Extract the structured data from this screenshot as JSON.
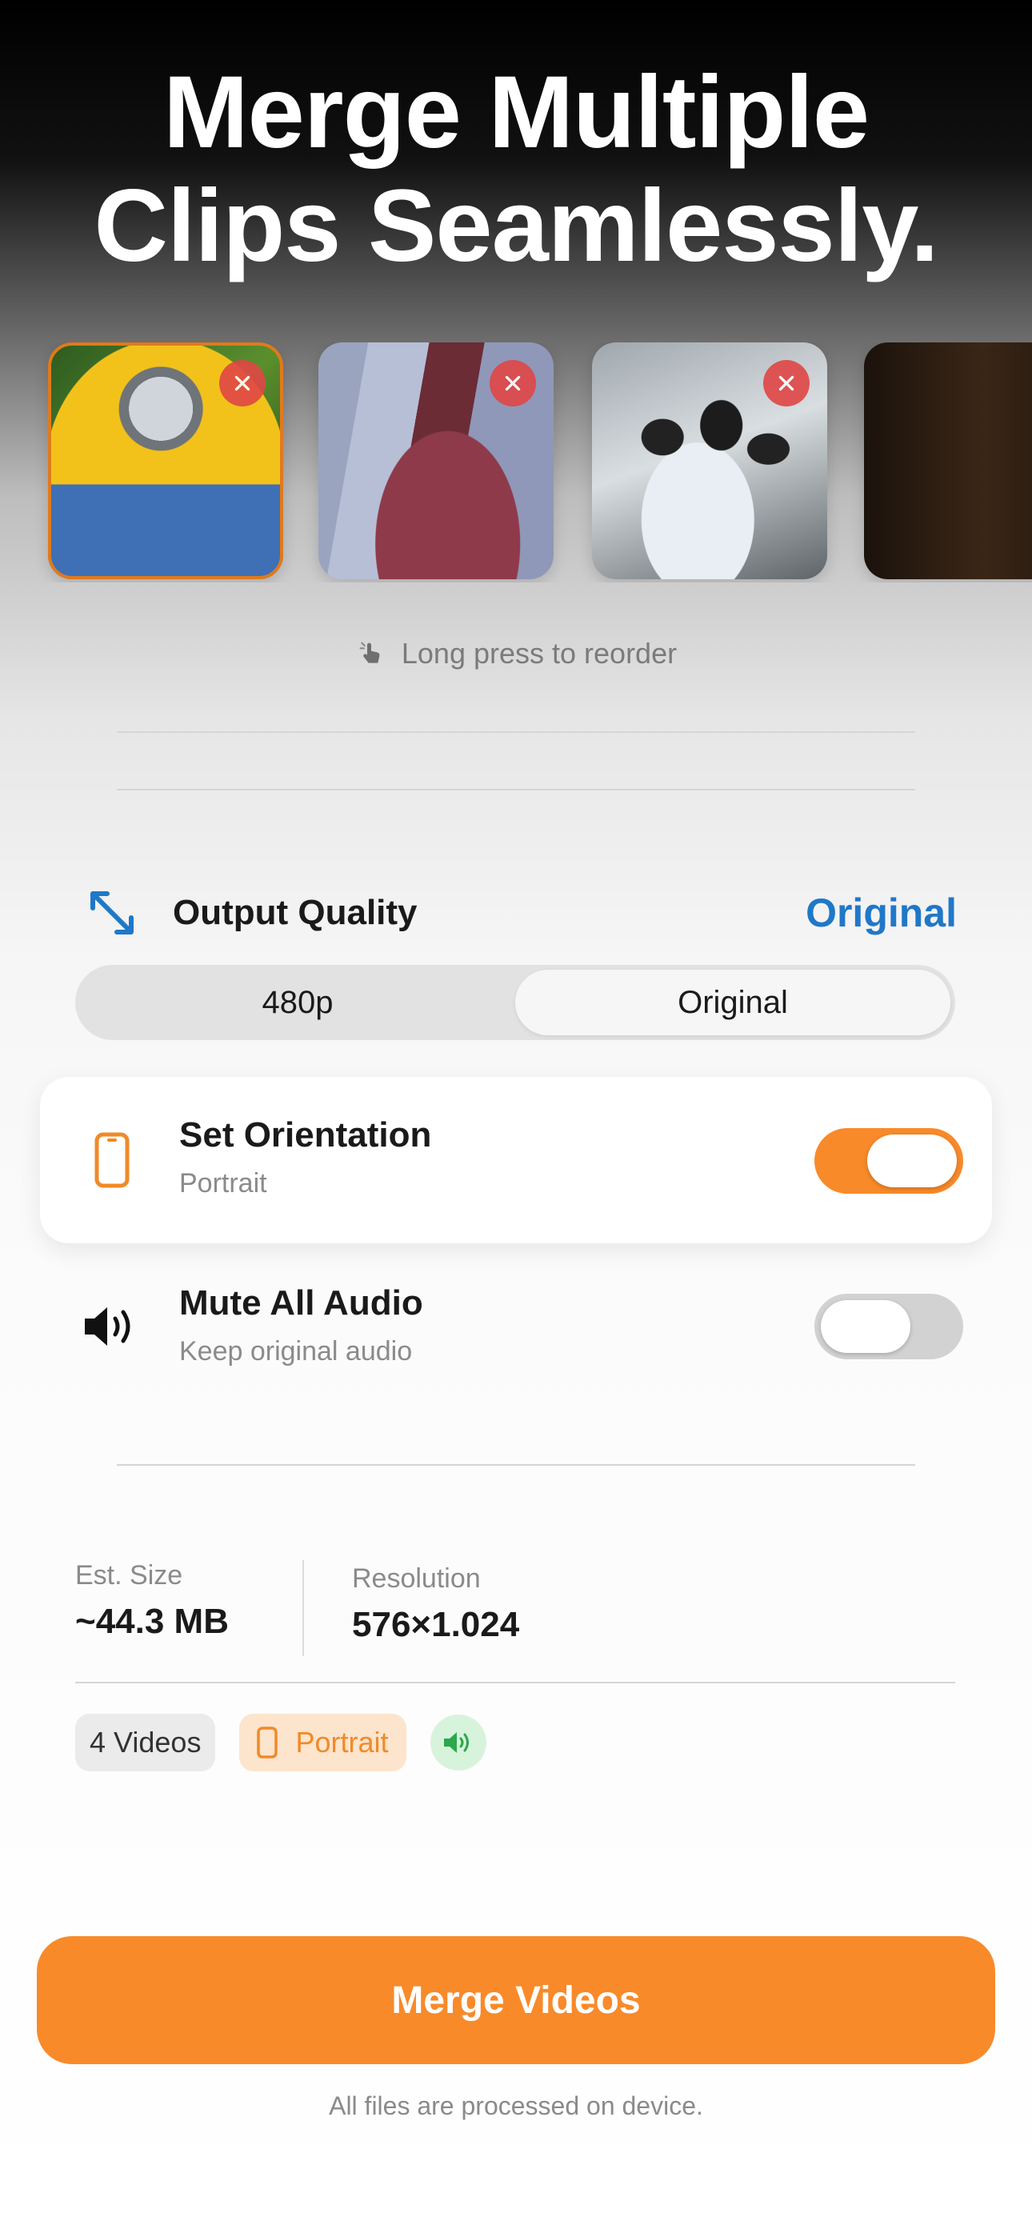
{
  "headline": {
    "line1": "Merge Multiple",
    "line2": "Clips Seamlessly."
  },
  "clips": [
    {
      "selected": true
    },
    {
      "selected": false
    },
    {
      "selected": false
    },
    {
      "selected": false
    }
  ],
  "hint": {
    "text": "Long press to reorder",
    "icon": "hand-pointer-icon"
  },
  "quality": {
    "title": "Output Quality",
    "value": "Original",
    "options": [
      "480p",
      "Original"
    ],
    "selected": "Original",
    "icon": "expand-arrows-icon",
    "accent": "#1f78c8"
  },
  "orientation": {
    "title": "Set Orientation",
    "subtitle": "Portrait",
    "enabled": true,
    "icon": "phone-portrait-icon"
  },
  "mute": {
    "title": "Mute All Audio",
    "subtitle": "Keep original audio",
    "enabled": false,
    "icon": "speaker-icon"
  },
  "stats": {
    "size_label": "Est. Size",
    "size_value": "~44.3 MB",
    "resolution_label": "Resolution",
    "resolution_value": "576×1.024"
  },
  "chips": {
    "videos": "4 Videos",
    "orientation": "Portrait",
    "audio_icon": "speaker-on-icon"
  },
  "merge_button": {
    "label": "Merge Videos",
    "color": "#f88a2a"
  },
  "footnote": "All files are processed on device."
}
